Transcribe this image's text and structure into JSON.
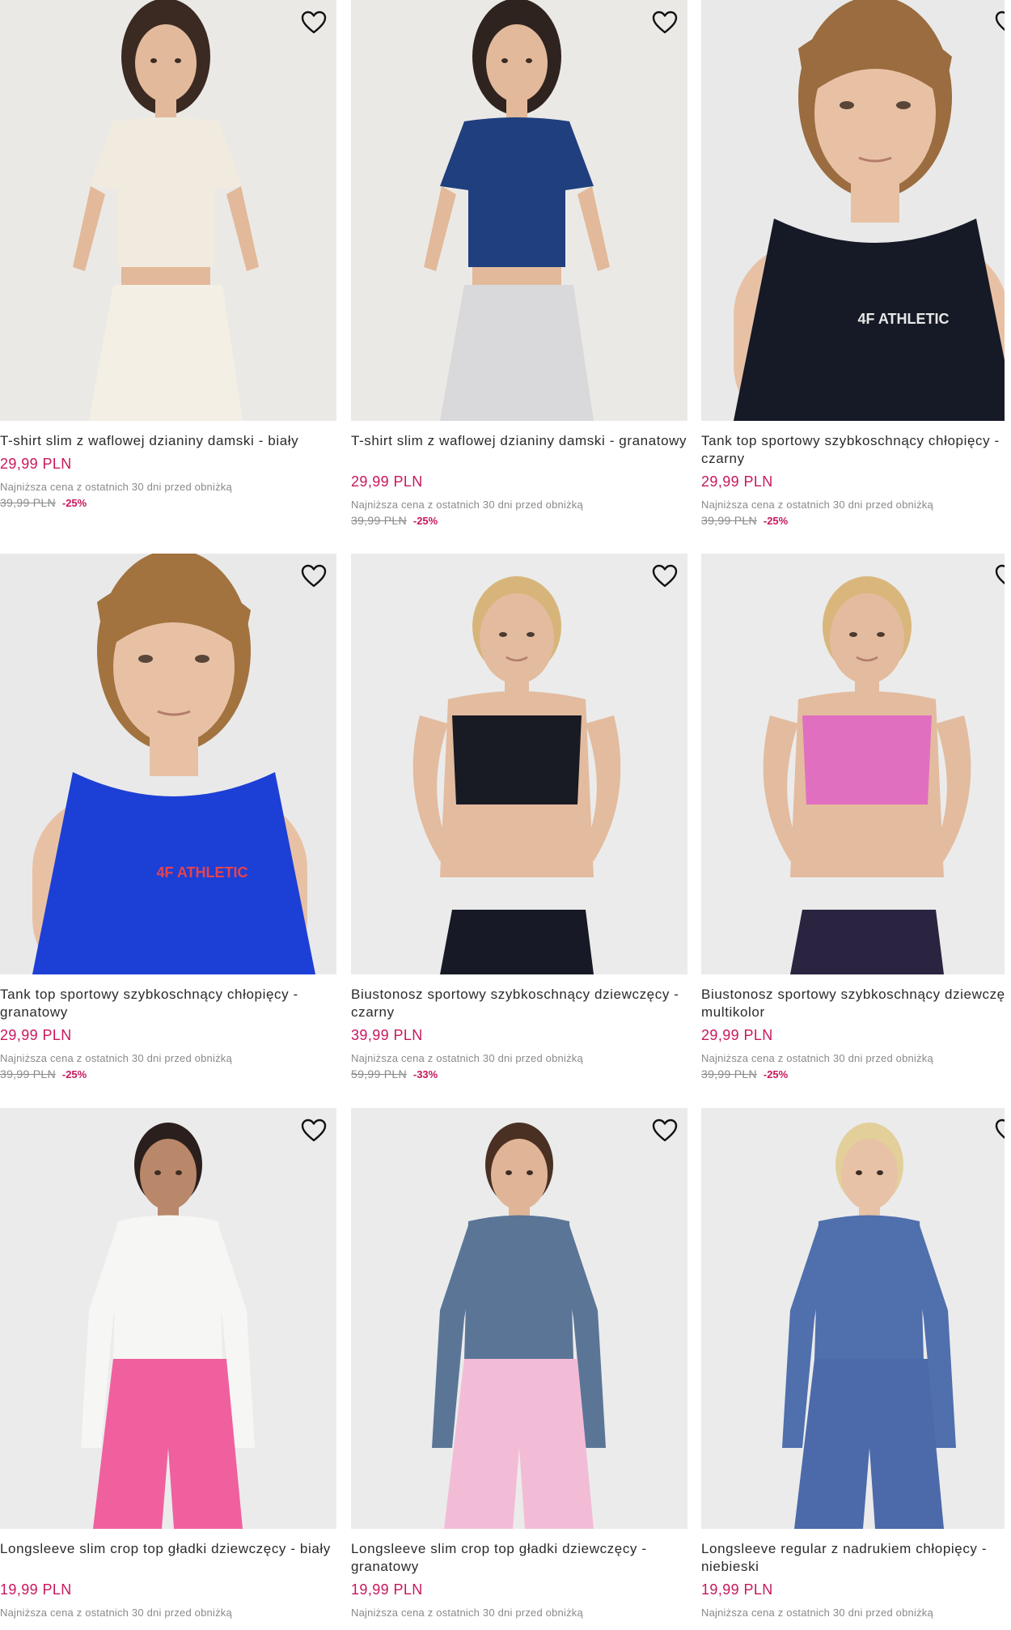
{
  "products": [
    {
      "title": "T-shirt slim z waflowej dzianiny damski - biały",
      "price": "29,99 PLN",
      "lowest_label": "Najniższa cena z ostatnich 30 dni przed obniżką",
      "old_price": "39,99 PLN",
      "discount": "-25%",
      "bg": "#ebe9e6",
      "top": "#f1ebdf",
      "bottom": "#f3efe4",
      "skin": "#e2b99a",
      "hair": "#3b2a22"
    },
    {
      "title": "T-shirt slim z waflowej dzianiny damski - granatowy",
      "price": "29,99 PLN",
      "lowest_label": "Najniższa cena z ostatnich 30 dni przed obniżką",
      "old_price": "39,99 PLN",
      "discount": "-25%",
      "bg": "#ebe9e6",
      "top": "#1f3f7e",
      "bottom": "#d9d9db",
      "skin": "#e2b99a",
      "hair": "#2f2320"
    },
    {
      "title": "Tank top sportowy szybkoschnący chłopięcy - czarny",
      "price": "29,99 PLN",
      "lowest_label": "Najniższa cena z ostatnich 30 dni przed obniżką",
      "old_price": "39,99 PLN",
      "discount": "-25%",
      "bg": "#e9e9e9",
      "top": "#151a26",
      "bottom": "#151a26",
      "skin": "#e8c1a5",
      "hair": "#9a6c3f",
      "print": "4F ATHLETIC"
    },
    {
      "title": "Tank top sportowy szybkoschnący chłopięcy - granatowy",
      "price": "29,99 PLN",
      "lowest_label": "Najniższa cena z ostatnich 30 dni przed obniżką",
      "old_price": "39,99 PLN",
      "discount": "-25%",
      "bg": "#e9e9e9",
      "top": "#1c3fd6",
      "bottom": "#1c3fd6",
      "skin": "#e8c1a5",
      "hair": "#a2733f",
      "print": "4F ATHLETIC"
    },
    {
      "title": "Biustonosz sportowy szybkoschnący dziewczęcy - czarny",
      "price": "39,99 PLN",
      "lowest_label": "Najniższa cena z ostatnich 30 dni przed obniżką",
      "old_price": "59,99 PLN",
      "discount": "-33%",
      "bg": "#ebebeb",
      "top": "#181a24",
      "bottom": "#171a26",
      "skin": "#e3bb9e",
      "hair": "#d7b57a"
    },
    {
      "title": "Biustonosz sportowy szybkoschnący dziewczęcy - multikolor",
      "price": "29,99 PLN",
      "lowest_label": "Najniższa cena z ostatnich 30 dni przed obniżką",
      "old_price": "39,99 PLN",
      "discount": "-25%",
      "bg": "#ebebeb",
      "top": "#e16fc0",
      "bottom": "#2a2440",
      "skin": "#e3bb9e",
      "hair": "#d9b77c"
    },
    {
      "title": "Longsleeve slim crop top gładki dziewczęcy - biały",
      "price": "19,99 PLN",
      "lowest_label": "Najniższa cena z ostatnich 30 dni przed obniżką",
      "old_price": "",
      "discount": "",
      "bg": "#ebebeb",
      "top": "#f6f6f4",
      "bottom": "#f0609e",
      "skin": "#b9876a",
      "hair": "#2a1f1c"
    },
    {
      "title": "Longsleeve slim crop top gładki dziewczęcy - granatowy",
      "price": "19,99 PLN",
      "lowest_label": "Najniższa cena z ostatnich 30 dni przed obniżką",
      "old_price": "",
      "discount": "",
      "bg": "#ebebeb",
      "top": "#5b7597",
      "bottom": "#f3bcd6",
      "skin": "#e0b597",
      "hair": "#4a3023"
    },
    {
      "title": "Longsleeve regular z nadrukiem chłopięcy - niebieski",
      "price": "19,99 PLN",
      "lowest_label": "Najniższa cena z ostatnich 30 dni przed obniżką",
      "old_price": "",
      "discount": "",
      "bg": "#ebebeb",
      "top": "#4f6fad",
      "bottom": "#4c6aaa",
      "skin": "#e8c2a6",
      "hair": "#e2cf9a"
    }
  ]
}
